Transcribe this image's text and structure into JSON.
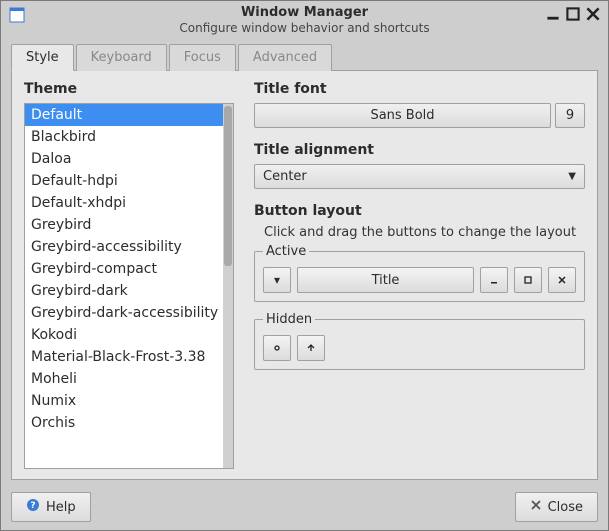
{
  "window": {
    "title": "Window Manager",
    "subtitle": "Configure window behavior and shortcuts"
  },
  "tabs": [
    {
      "label": "Style"
    },
    {
      "label": "Keyboard"
    },
    {
      "label": "Focus"
    },
    {
      "label": "Advanced"
    }
  ],
  "theme": {
    "label": "Theme",
    "items": [
      "Default",
      "Blackbird",
      "Daloa",
      "Default-hdpi",
      "Default-xhdpi",
      "Greybird",
      "Greybird-accessibility",
      "Greybird-compact",
      "Greybird-dark",
      "Greybird-dark-accessibility",
      "Kokodi",
      "Material-Black-Frost-3.38",
      "Moheli",
      "Numix",
      "Orchis"
    ],
    "selected": 0
  },
  "title_font": {
    "label": "Title font",
    "name": "Sans Bold",
    "size": "9"
  },
  "title_align": {
    "label": "Title alignment",
    "value": "Center"
  },
  "button_layout": {
    "label": "Button layout",
    "hint": "Click and drag the buttons to change the layout",
    "active_legend": "Active",
    "hidden_legend": "Hidden",
    "title_btn": "Title"
  },
  "footer": {
    "help": "Help",
    "close": "Close"
  }
}
